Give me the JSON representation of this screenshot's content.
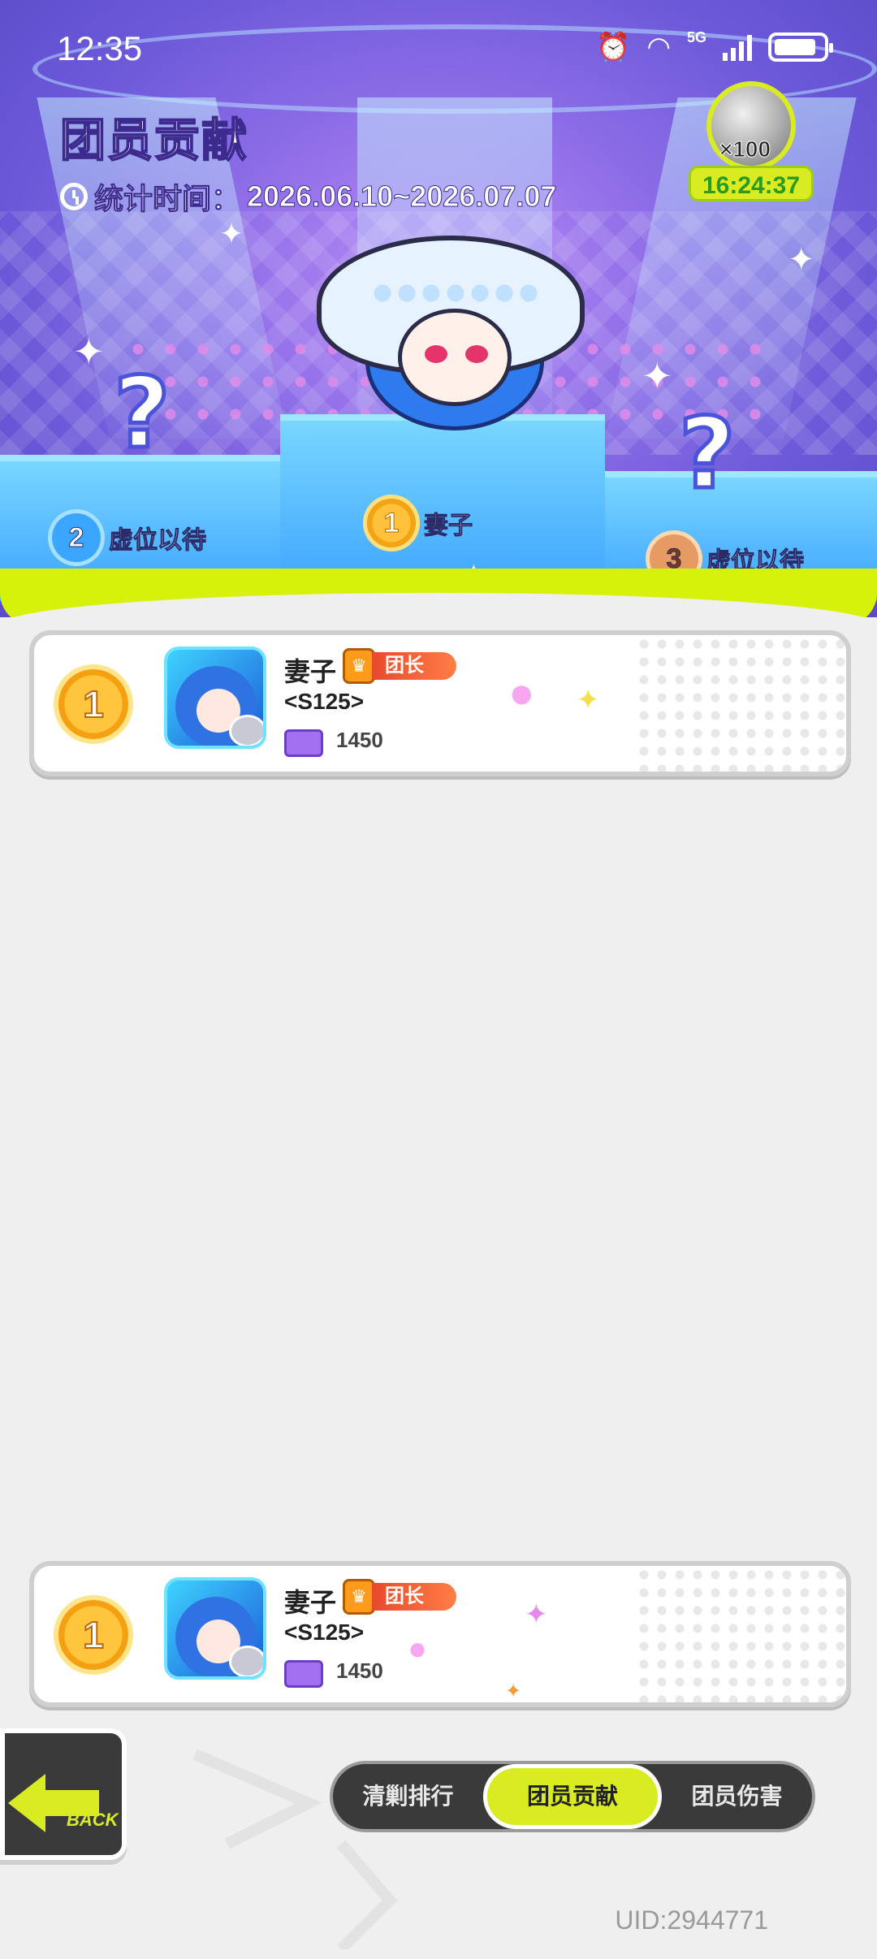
{
  "status_bar": {
    "time": "12:35",
    "network": "5G"
  },
  "header": {
    "title": "团员贡献",
    "stat_label": "统计时间：",
    "stat_range": "2026.06.10~2026.07.07"
  },
  "reward": {
    "count": "×100",
    "timer": "16:24:37"
  },
  "podium": [
    {
      "rank": "1",
      "name": "妻子"
    },
    {
      "rank": "2",
      "name": "虚位以待"
    },
    {
      "rank": "3",
      "name": "虚位以待"
    }
  ],
  "list": [
    {
      "rank": "1",
      "name": "妻子",
      "role": "团长",
      "server": "<S125>",
      "score": "1450"
    }
  ],
  "my_entry": {
    "rank": "1",
    "name": "妻子",
    "role": "团长",
    "server": "<S125>",
    "score": "1450"
  },
  "back_label": "BACK",
  "tabs": [
    {
      "label": "清剿排行",
      "active": false
    },
    {
      "label": "团员贡献",
      "active": true
    },
    {
      "label": "团员伤害",
      "active": false
    }
  ],
  "uid": "UID:2944771",
  "colors": {
    "accent": "#d9ec21",
    "stage": "#7a63e0",
    "leader": "#e8492c"
  }
}
